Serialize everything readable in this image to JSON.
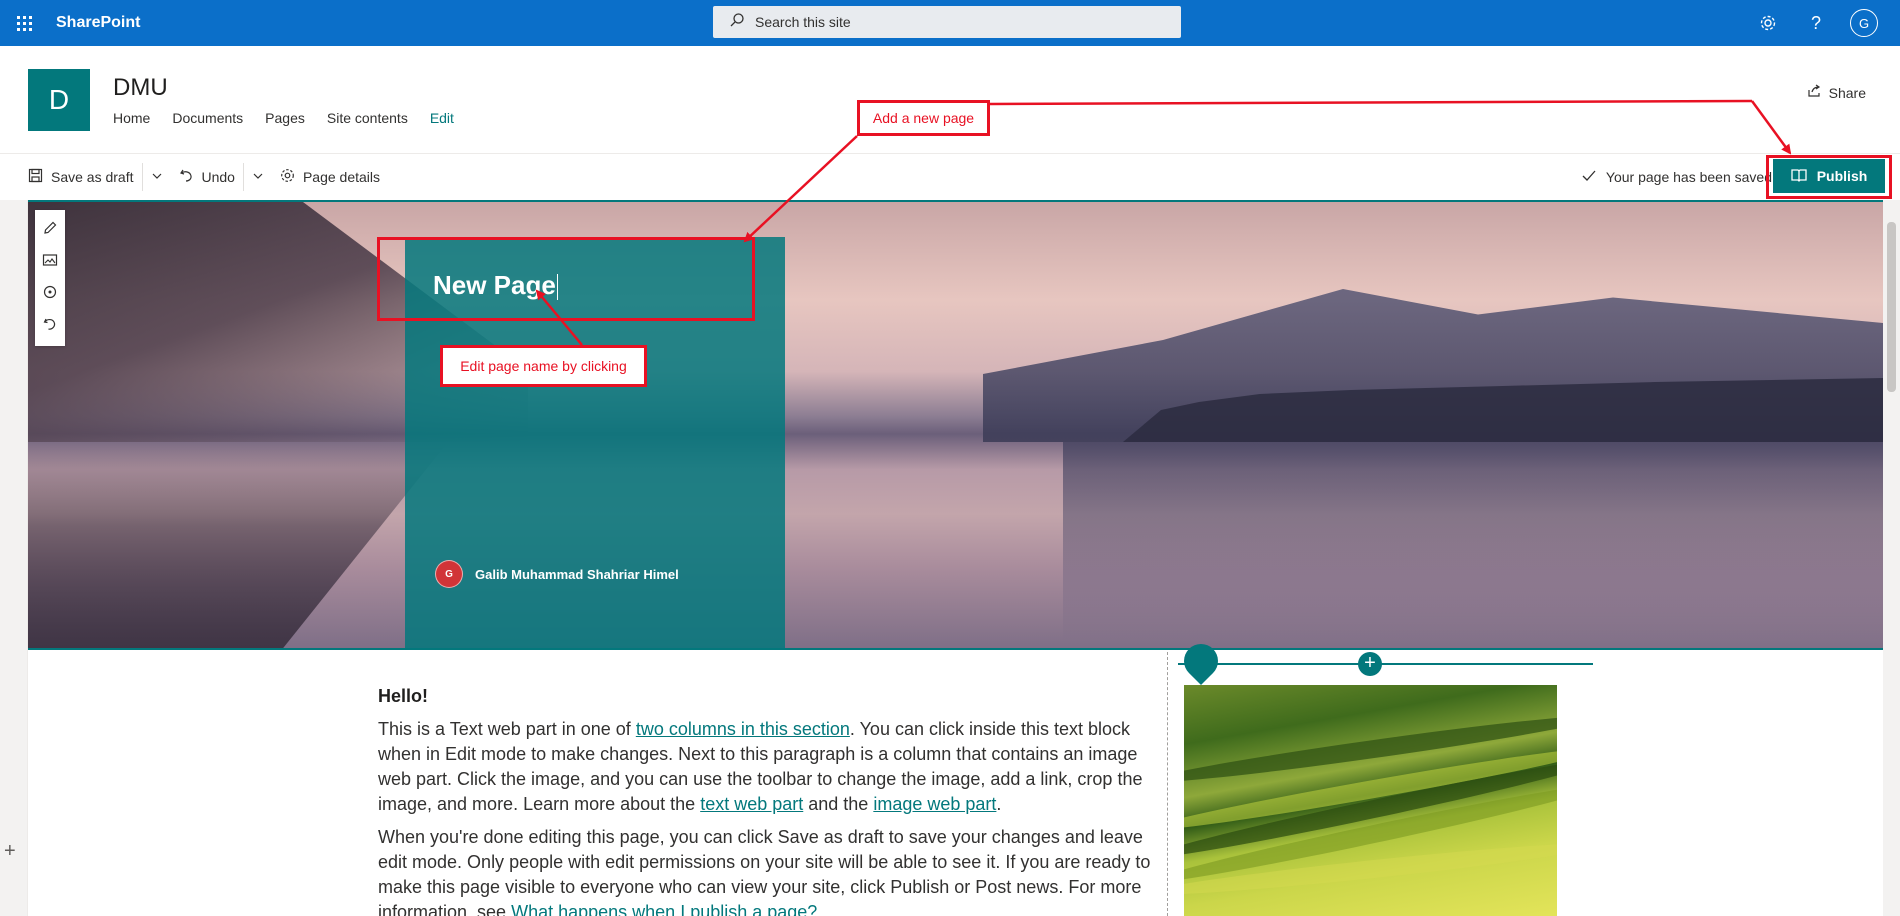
{
  "suitebar": {
    "brand": "SharePoint",
    "search_placeholder": "Search this site",
    "user_initial": "G"
  },
  "site": {
    "logo_letter": "D",
    "title": "DMU",
    "nav": [
      "Home",
      "Documents",
      "Pages",
      "Site contents",
      "Edit"
    ],
    "share_label": "Share"
  },
  "commandbar": {
    "save_label": "Save as draft",
    "undo_label": "Undo",
    "details_label": "Page details",
    "saved_status": "Your page has been saved",
    "publish_label": "Publish"
  },
  "hero": {
    "page_title": "New Page",
    "author_initial": "G",
    "author_name": "Galib Muhammad Shahriar Himel"
  },
  "annotations": {
    "add_page": "Add a new page",
    "edit_name": "Edit page name by clicking"
  },
  "content": {
    "heading": "Hello!",
    "p1_a": "This is a Text web part in one of ",
    "p1_link1": "two columns in this section",
    "p1_b": ". You can click inside this text block when in Edit mode to make changes. Next to this paragraph is a column that contains an image web part. Click the image, and you can use the toolbar to change the image, add a link, crop the image, and more. Learn more about the ",
    "p1_link2": "text web part",
    "p1_c": " and the ",
    "p1_link3": "image web part",
    "p1_d": ".",
    "p2_a": "When you're done editing this page, you can click Save as draft to save your changes and leave edit mode. Only people with edit permissions on your site will be able to see it. If you are ready to make this page visible to everyone who can view your site, click Publish or Post news. For more information, see ",
    "p2_link": "What happens when I publish a page?"
  },
  "colors": {
    "suitebar": "#0b6fc9",
    "theme": "#03787c",
    "annotation": "#e81123"
  }
}
